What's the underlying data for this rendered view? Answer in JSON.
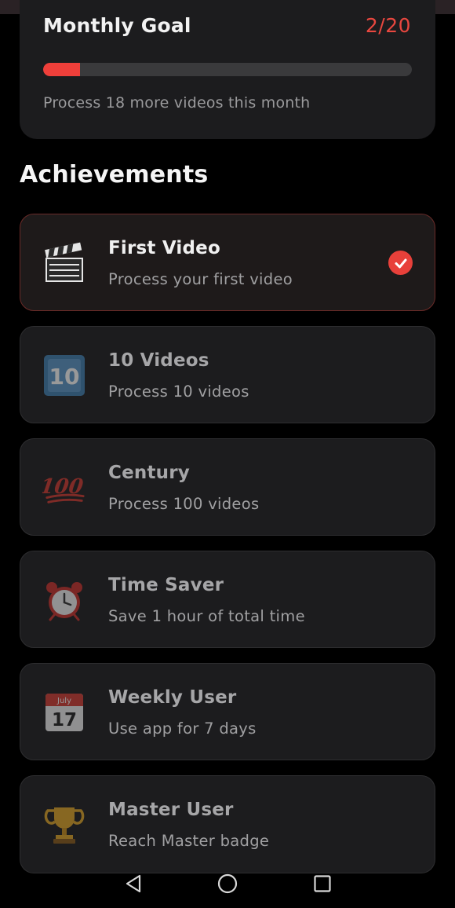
{
  "goal": {
    "title": "Monthly Goal",
    "count": "2/20",
    "progress_fraction": 0.1,
    "subtitle": "Process 18 more videos this month"
  },
  "achievements_title": "Achievements",
  "achievements": [
    {
      "title": "First Video",
      "desc": "Process your first video",
      "icon": "clapper-board-icon",
      "unlocked": true
    },
    {
      "title": "10 Videos",
      "desc": "Process 10 videos",
      "icon": "keycap-ten-icon",
      "unlocked": false
    },
    {
      "title": "Century",
      "desc": "Process 100 videos",
      "icon": "hundred-points-icon",
      "unlocked": false
    },
    {
      "title": "Time Saver",
      "desc": "Save 1 hour of total time",
      "icon": "alarm-clock-icon",
      "unlocked": false
    },
    {
      "title": "Weekly User",
      "desc": "Use app for 7 days",
      "icon": "calendar-icon",
      "unlocked": false
    },
    {
      "title": "Master User",
      "desc": "Reach Master badge",
      "icon": "trophy-icon",
      "unlocked": false
    }
  ],
  "calendar_icon": {
    "month": "July",
    "day": "17"
  },
  "keycap_icon": {
    "text": "10"
  },
  "hundred_icon": {
    "text": "100"
  },
  "colors": {
    "accent": "#e8403a",
    "card": "#1c1c1e",
    "background": "#000000"
  }
}
